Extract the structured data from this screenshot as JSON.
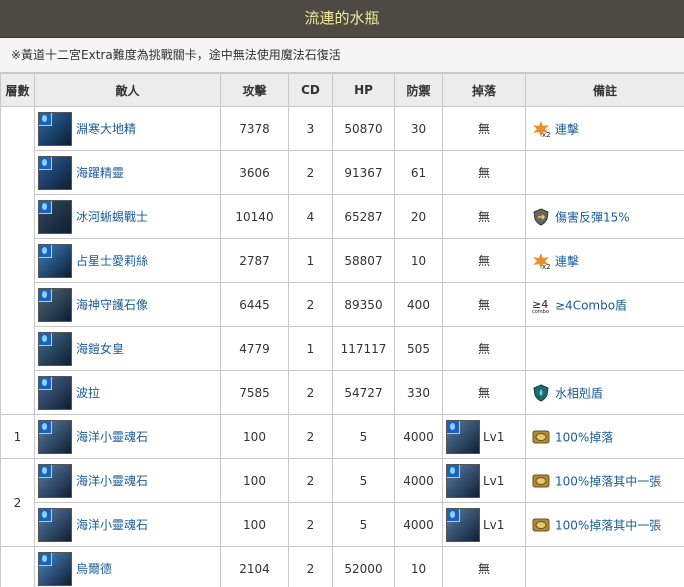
{
  "title": "流連的水瓶",
  "note": "※黃道十二宮Extra難度為挑戰關卡，途中無法使用魔法石復活",
  "headers": [
    "層數",
    "敵人",
    "攻擊",
    "CD",
    "HP",
    "防禦",
    "掉落",
    "備註"
  ],
  "rows": [
    {
      "floor": "",
      "name": "淵寒大地精",
      "atk": "7378",
      "cd": "3",
      "hp": "50870",
      "def": "30",
      "drop": "無",
      "remark": "連擊",
      "remark_icon": "combo-x2-icon",
      "avatar_color": "#2a6aa8"
    },
    {
      "floor": "",
      "name": "海躍精靈",
      "atk": "3606",
      "cd": "2",
      "hp": "91367",
      "def": "61",
      "drop": "無",
      "remark": "",
      "remark_icon": "",
      "avatar_color": "#2d5d9a"
    },
    {
      "floor": "",
      "name": "冰河蜥蜴戰士",
      "atk": "10140",
      "cd": "4",
      "hp": "65287",
      "def": "20",
      "drop": "無",
      "remark": "傷害反彈15%",
      "remark_icon": "shield-reflect-icon",
      "avatar_color": "#33495e"
    },
    {
      "floor": "",
      "name": "占星士愛莉絲",
      "atk": "2787",
      "cd": "1",
      "hp": "58807",
      "def": "10",
      "drop": "無",
      "remark": "連擊",
      "remark_icon": "combo-x2-icon",
      "avatar_color": "#3a80c0"
    },
    {
      "floor": "",
      "name": "海神守護石像",
      "atk": "6445",
      "cd": "2",
      "hp": "89350",
      "def": "400",
      "drop": "無",
      "remark": "≥4Combo盾",
      "remark_icon": "combo-4-shield-icon",
      "avatar_color": "#4f6a78"
    },
    {
      "floor": "",
      "name": "海鎧女皇",
      "atk": "4779",
      "cd": "1",
      "hp": "117117",
      "def": "505",
      "drop": "無",
      "remark": "",
      "remark_icon": "",
      "avatar_color": "#3c6e8a"
    },
    {
      "floor": "",
      "name": "波拉",
      "atk": "7585",
      "cd": "2",
      "hp": "54727",
      "def": "330",
      "drop": "無",
      "remark": "水相剋盾",
      "remark_icon": "water-shield-icon",
      "avatar_color": "#4a6690"
    },
    {
      "floor": "1",
      "name": "海洋小靈魂石",
      "atk": "100",
      "cd": "2",
      "hp": "5",
      "def": "4000",
      "drop": "Lv1",
      "remark": "100%掉落",
      "remark_icon": "coin-icon",
      "avatar_color": "#5a7fa8"
    },
    {
      "floor": "2",
      "name": "海洋小靈魂石",
      "atk": "100",
      "cd": "2",
      "hp": "5",
      "def": "4000",
      "drop": "Lv1",
      "remark": "100%掉落其中一張",
      "remark_icon": "coin-icon",
      "avatar_color": "#5a7fa8"
    },
    {
      "floor": "",
      "name": "海洋小靈魂石",
      "atk": "100",
      "cd": "2",
      "hp": "5",
      "def": "4000",
      "drop": "Lv1",
      "remark": "100%掉落其中一張",
      "remark_icon": "coin-icon",
      "avatar_color": "#5a7fa8"
    },
    {
      "floor": "",
      "name": "烏爾德",
      "atk": "2104",
      "cd": "2",
      "hp": "52000",
      "def": "10",
      "drop": "無",
      "remark": "",
      "remark_icon": "",
      "avatar_color": "#4d8ac4"
    }
  ],
  "colors": {
    "title_bg": "#4d4a44",
    "title_text": "#f3e89a",
    "link": "#1a5b9a",
    "border": "#c8c8c8",
    "header_bg": "#ececec"
  }
}
